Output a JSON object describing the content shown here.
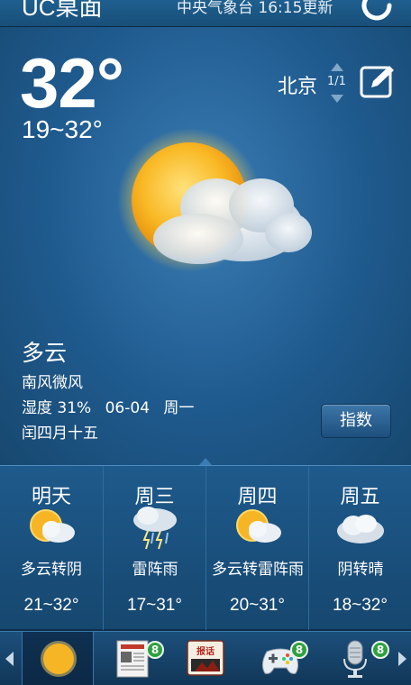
{
  "header": {
    "app_title": "UC桌面",
    "update_info": "中央气象台 16:15更新"
  },
  "current": {
    "temperature": "32°",
    "range": "19~32°",
    "city": "北京",
    "pager": "1/1",
    "condition": "多云",
    "wind": "南风微风",
    "humidity": "湿度 31%",
    "date": "06-04",
    "weekday": "周一",
    "lunar_date": "闰四月十五",
    "index_button": "指数",
    "icon": "sun-cloud-icon"
  },
  "forecast": [
    {
      "day": "明天",
      "condition": "多云转阴",
      "range": "21~32°",
      "icon": "sun-cloud-icon"
    },
    {
      "day": "周三",
      "condition": "雷阵雨",
      "range": "17~31°",
      "icon": "thunderstorm-icon"
    },
    {
      "day": "周四",
      "condition": "多云转雷阵雨",
      "range": "20~31°",
      "icon": "sun-cloud-icon"
    },
    {
      "day": "周五",
      "condition": "阴转晴",
      "range": "18~32°",
      "icon": "cloud-icon"
    }
  ],
  "dock": {
    "apps": [
      {
        "icon": "weather-sun-icon"
      },
      {
        "icon": "newspaper-icon",
        "badge": "8"
      },
      {
        "icon": "news-app-icon",
        "label": "报话"
      },
      {
        "icon": "gamepad-icon",
        "badge": "8"
      },
      {
        "icon": "microphone-icon",
        "badge": "8"
      }
    ]
  },
  "colors": {
    "panel": "#1f5a8e",
    "accent": "#3a7db4",
    "badge": "#2fa040"
  }
}
